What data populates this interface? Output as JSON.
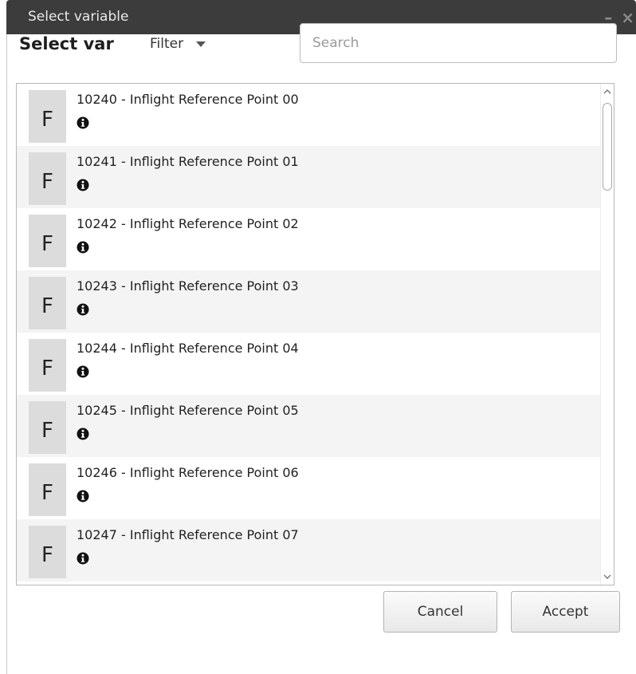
{
  "window": {
    "title": "Select variable",
    "controls_icon": "minimize-close-icon",
    "controls_text": "– ×"
  },
  "header": {
    "heading": "Select var",
    "filter_label": "Filter",
    "search_placeholder": "Search",
    "search_value": ""
  },
  "list": {
    "badge_letter": "F",
    "items": [
      {
        "label": "10240 - Inflight Reference Point 00",
        "icon": "info-icon"
      },
      {
        "label": "10241 - Inflight Reference Point 01",
        "icon": "info-icon"
      },
      {
        "label": "10242 - Inflight Reference Point 02",
        "icon": "info-icon"
      },
      {
        "label": "10243 - Inflight Reference Point 03",
        "icon": "info-icon"
      },
      {
        "label": "10244 - Inflight Reference Point 04",
        "icon": "info-icon"
      },
      {
        "label": "10245 - Inflight Reference Point 05",
        "icon": "info-icon"
      },
      {
        "label": "10246 - Inflight Reference Point 06",
        "icon": "info-icon"
      },
      {
        "label": "10247 - Inflight Reference Point 07",
        "icon": "info-icon"
      }
    ]
  },
  "footer": {
    "cancel_label": "Cancel",
    "accept_label": "Accept"
  },
  "colors": {
    "titlebar": "#3c3c3c",
    "row_alt": "#f4f4f4",
    "badge": "#dcdcdc"
  }
}
